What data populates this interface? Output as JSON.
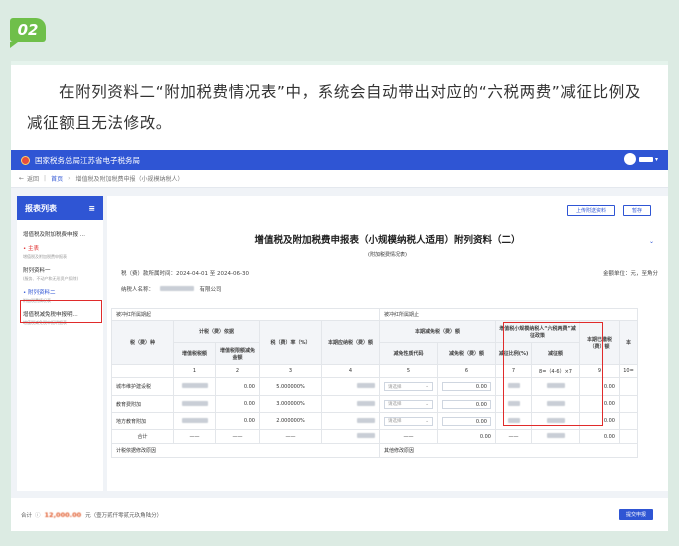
{
  "badge": "02",
  "caption": "在附列资料二“附加税费情况表”中，系统会自动带出对应的“六税两费”减征比例及减征额且无法修改。",
  "app": {
    "title": "国家税务总局江苏省电子税务局",
    "breadcrumb": {
      "back": "返回",
      "home": "首页",
      "current": "增值税及附加税费申报（小规模纳税人）"
    }
  },
  "sidebar": {
    "title": "报表列表",
    "items": [
      {
        "label": "增值税及附加税费申报 ...",
        "sub": ""
      },
      {
        "label": "• 主表",
        "sub": "增值税及附加税费申报表"
      },
      {
        "label": "附列资料一",
        "sub": "(服务、不动产和无形资产扣除)"
      },
      {
        "label": "• 附列资料二",
        "sub": "附加税费情况表"
      },
      {
        "label": "增值税减免税申报明...",
        "sub": "增值税减免税申报明细表"
      }
    ]
  },
  "toolbar": {
    "upload": "上传附送资料",
    "save": "暂存"
  },
  "form": {
    "title": "增值税及附加税费申报表（小规模纳税人适用）附列资料（二）",
    "subtitle": "(附加税费情况表)",
    "period_label": "税（费）款所属时间：",
    "period_value": "2024-04-01 至 2024-06-30",
    "taxpayer_label": "纳税人名称：",
    "taxpayer_value": "有限公司",
    "unit": "金额单位：元，至角分",
    "hdr": {
      "band_left": "被冲红所属期起",
      "band_right": "被冲红所属期止",
      "tax_type": "税（费）种",
      "basis": "计税（费）依据",
      "vat_tax": "增值税税额",
      "vat_deduct": "增值税限额减免金额",
      "rate": "税（费）率（%）",
      "due": "本期应纳税（费）额",
      "relief": "本期减免税（费）额",
      "relief_code": "减免性质代码",
      "relief_amt": "减免税（费）额",
      "policy": "增值税小规模纳税人“六税两费”减征政策",
      "policy_rate": "减征比例(%)",
      "policy_amt": "减征额",
      "paid": "本期已缴税（费）额",
      "payable": "本"
    },
    "cols": [
      "1",
      "2",
      "3",
      "4",
      "5",
      "6",
      "7",
      "8=（4-6）×7",
      "9",
      "10="
    ],
    "select_placeholder": "请选择",
    "rows": [
      {
        "name": "城市维护建设税",
        "col2": "0.00",
        "rate": "5.000000%",
        "col6": "0.00",
        "col9": "0.00"
      },
      {
        "name": "教育费附加",
        "col2": "0.00",
        "rate": "3.000000%",
        "col6": "0.00",
        "col9": "0.00"
      },
      {
        "name": "地方教育附加",
        "col2": "0.00",
        "rate": "2.000000%",
        "col6": "0.00",
        "col9": "0.00"
      }
    ],
    "total_row": {
      "name": "合计",
      "dash": "——",
      "col6": "0.00",
      "col9": "0.00"
    },
    "bottom_left": "计税依据修改原因",
    "bottom_right": "其他修改原因"
  },
  "footer": {
    "total_label": "合计",
    "amount": "12,000.00",
    "unit": "元（壹万贰仟零贰元玖角陆分）",
    "submit": "提交申报"
  }
}
